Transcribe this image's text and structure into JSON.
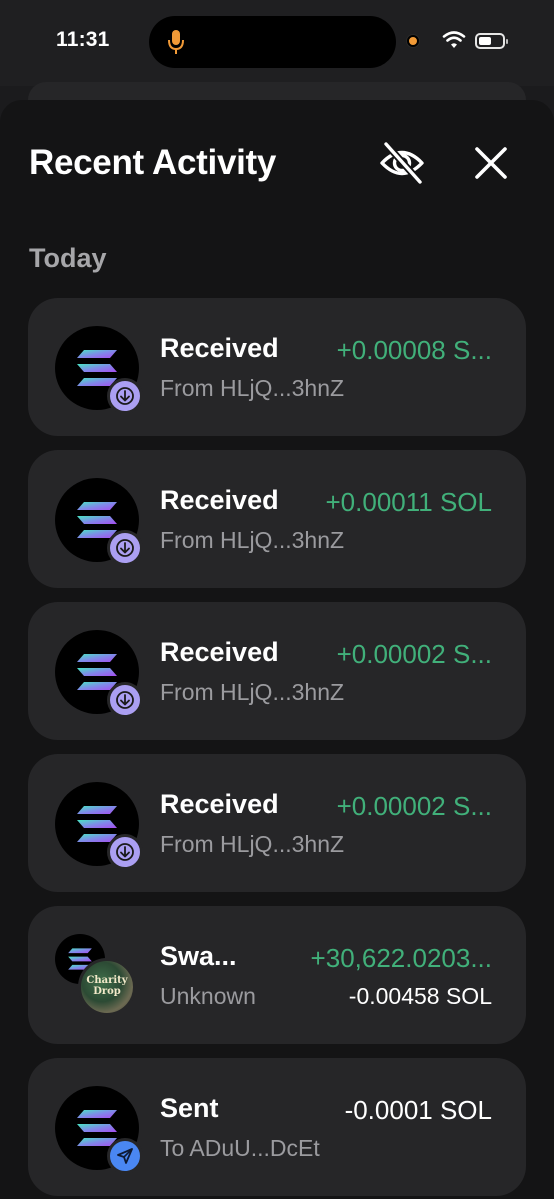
{
  "status_bar": {
    "time": "11:31"
  },
  "header": {
    "title": "Recent Activity"
  },
  "section": {
    "label": "Today"
  },
  "activities": [
    {
      "type": "received",
      "label": "Received",
      "subtitle": "From HLjQ...3hnZ",
      "amount": "+0.00008 S...",
      "amount_color": "#41b07a"
    },
    {
      "type": "received",
      "label": "Received",
      "subtitle": "From HLjQ...3hnZ",
      "amount": "+0.00011 SOL",
      "amount_color": "#41b07a"
    },
    {
      "type": "received",
      "label": "Received",
      "subtitle": "From HLjQ...3hnZ",
      "amount": "+0.00002 S...",
      "amount_color": "#41b07a"
    },
    {
      "type": "received",
      "label": "Received",
      "subtitle": "From HLjQ...3hnZ",
      "amount": "+0.00002 S...",
      "amount_color": "#41b07a"
    },
    {
      "type": "swap",
      "label": "Swa...",
      "subtitle": "Unknown",
      "amount": "+30,622.0203...",
      "amount_secondary": "-0.00458 SOL",
      "token_badge_text": "Charity Drop"
    },
    {
      "type": "sent",
      "label": "Sent",
      "subtitle": "To ADuU...DcEt",
      "amount": "-0.0001 SOL"
    }
  ],
  "icons": {
    "token": "solana-logo-icon",
    "received_badge": "arrow-down-icon",
    "sent_badge": "send-plane-icon",
    "hide": "eye-off-icon",
    "close": "close-icon"
  },
  "colors": {
    "accent_received": "#ab9ff2",
    "accent_sent": "#4a87f2",
    "positive": "#41b07a",
    "record_indicator": "#f19a37"
  }
}
